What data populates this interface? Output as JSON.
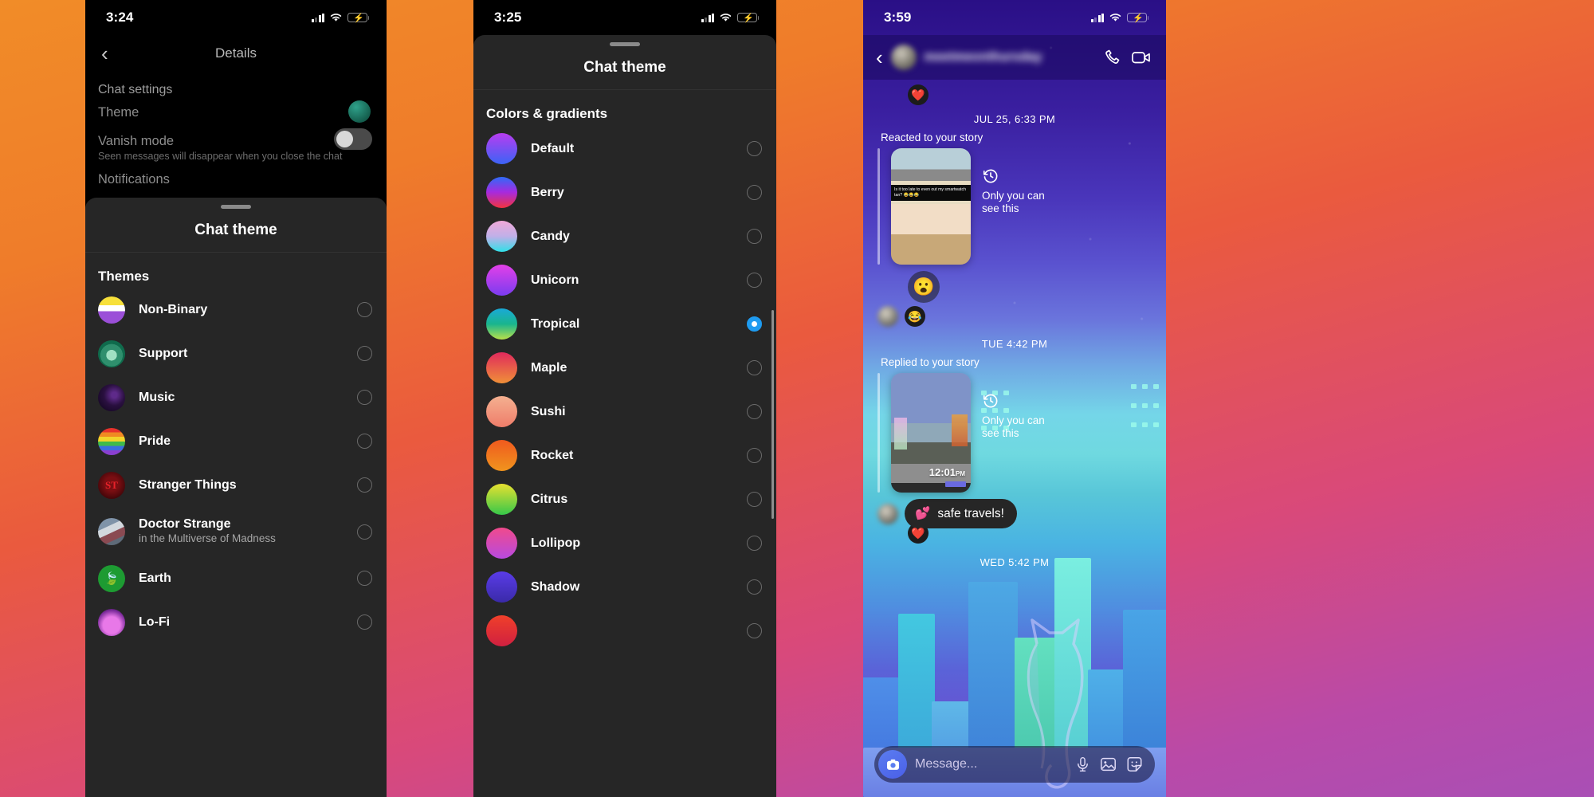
{
  "wallpaper": {
    "gradient_start": "#f18c28",
    "gradient_end": "#a94fb5"
  },
  "phone1": {
    "status": {
      "time": "3:24"
    },
    "nav": {
      "back_icon": "chevron-left-icon",
      "title": "Details"
    },
    "settings": {
      "section_label": "Chat settings",
      "theme_label": "Theme",
      "vanish_label": "Vanish mode",
      "vanish_sub": "Seen messages will disappear when you close the chat",
      "notifications_label": "Notifications"
    },
    "sheet": {
      "title": "Chat theme",
      "group_label": "Themes",
      "items": [
        {
          "label": "Non-Binary",
          "sub": "",
          "selected": false
        },
        {
          "label": "Support",
          "sub": "",
          "selected": false
        },
        {
          "label": "Music",
          "sub": "",
          "selected": false
        },
        {
          "label": "Pride",
          "sub": "",
          "selected": false
        },
        {
          "label": "Stranger Things",
          "sub": "",
          "selected": false
        },
        {
          "label": "Doctor Strange",
          "sub": "in the Multiverse of Madness",
          "selected": false
        },
        {
          "label": "Earth",
          "sub": "",
          "selected": false
        },
        {
          "label": "Lo-Fi",
          "sub": "",
          "selected": false
        }
      ]
    }
  },
  "phone2": {
    "status": {
      "time": "3:25"
    },
    "sheet": {
      "title": "Chat theme",
      "group_label": "Colors & gradients",
      "items": [
        {
          "label": "Default",
          "colors": [
            "#b83cf0",
            "#3b63f6"
          ],
          "selected": false
        },
        {
          "label": "Berry",
          "colors": [
            "#2f6bf8",
            "#f2333f"
          ],
          "selected": false
        },
        {
          "label": "Candy",
          "colors": [
            "#f0a8d8",
            "#2fe0e8"
          ],
          "selected": false
        },
        {
          "label": "Unicorn",
          "colors": [
            "#e340e8",
            "#7a3cf0"
          ],
          "selected": false
        },
        {
          "label": "Tropical",
          "colors": [
            "#1aa9d8",
            "#b8e04a"
          ],
          "selected": true
        },
        {
          "label": "Maple",
          "colors": [
            "#e02a5c",
            "#f09038"
          ],
          "selected": false
        },
        {
          "label": "Sushi",
          "colors": [
            "#f4b090",
            "#ef7d6a"
          ],
          "selected": false
        },
        {
          "label": "Rocket",
          "colors": [
            "#f05a1e",
            "#f0941e"
          ],
          "selected": false
        },
        {
          "label": "Citrus",
          "colors": [
            "#e8e030",
            "#36c84a"
          ],
          "selected": false
        },
        {
          "label": "Lollipop",
          "colors": [
            "#f04a8c",
            "#b84ae0"
          ],
          "selected": false
        },
        {
          "label": "Shadow",
          "colors": [
            "#5a3ce8",
            "#3a2aa8"
          ],
          "selected": false
        },
        {
          "label": "",
          "colors": [
            "#f0402a",
            "#d02040"
          ],
          "selected": false
        }
      ]
    }
  },
  "phone3": {
    "status": {
      "time": "3:59"
    },
    "header": {
      "back_icon": "chevron-left-icon",
      "username": "meetmeonthursday",
      "call_icon": "phone-icon",
      "video_icon": "video-camera-icon"
    },
    "messages": {
      "day1": "JUL 25, 6:33 PM",
      "reacted_label": "Reacted to your story",
      "story1_caption": "Is it too late to even out my smartwatch tan? 😂😂😂",
      "only_you_1": "Only you can\nsee this",
      "emoji1": "😮",
      "emoji2": "😂",
      "day2": "TUE 4:42 PM",
      "replied_label": "Replied to your story",
      "story2_time": "12:01",
      "story2_ampm": "PM",
      "only_you_2": "Only you can\nsee this",
      "bubble_text": "safe travels!",
      "bubble_emoji": "💕",
      "bubble_reaction": "❤️",
      "top_reaction": "❤️",
      "day3": "WED 5:42 PM"
    },
    "composer": {
      "camera_icon": "camera-icon",
      "placeholder": "Message...",
      "mic_icon": "microphone-icon",
      "gallery_icon": "image-icon",
      "sticker_icon": "sticker-icon"
    }
  }
}
